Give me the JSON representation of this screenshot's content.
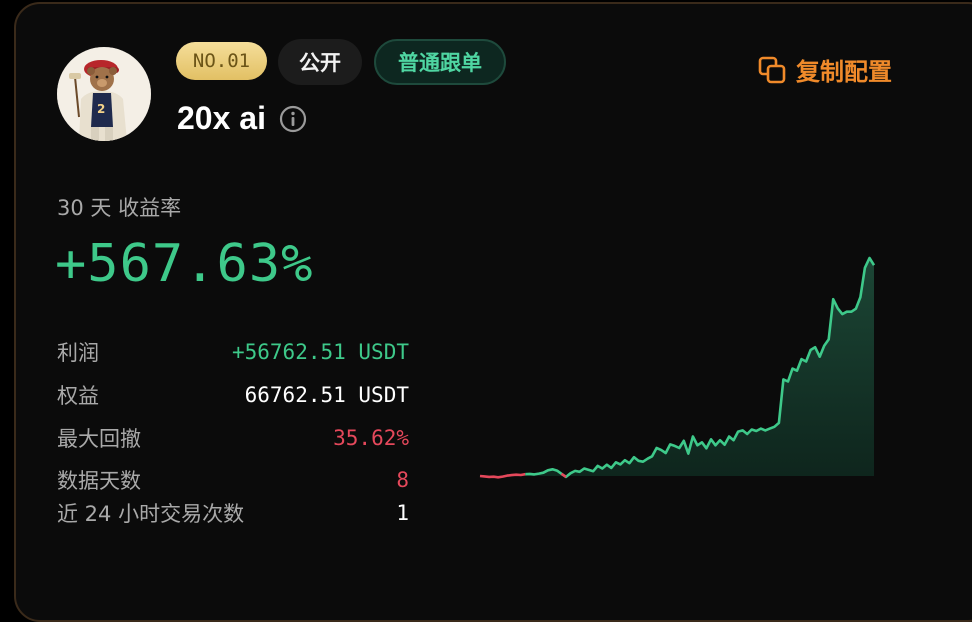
{
  "header": {
    "rank_badge": "NO.01",
    "visibility_badge": "公开",
    "mode_badge": "普通跟单",
    "copy_button_label": "复制配置",
    "trader_name": "20x ai"
  },
  "metric": {
    "label": "30 天 收益率",
    "roi": "+567.63%"
  },
  "stats": [
    {
      "label": "利润",
      "value": "+56762.51 USDT",
      "tone": "green"
    },
    {
      "label": "权益",
      "value": "66762.51 USDT",
      "tone": "white"
    },
    {
      "label": "最大回撤",
      "value": "35.62%",
      "tone": "red"
    },
    {
      "label": "数据天数",
      "value": "8",
      "tone": "red"
    },
    {
      "label": "近 24 小时交易次数",
      "value": "1",
      "tone": "white"
    }
  ],
  "colors": {
    "accent_green": "#3ec98a",
    "accent_red": "#e5485b",
    "accent_orange": "#f08a2a",
    "gold": "#e2c064"
  },
  "icons": {
    "info": "info-icon",
    "copy": "copy-icon"
  },
  "chart_data": {
    "type": "area",
    "y": [
      0,
      -0.3,
      -0.6,
      -0.5,
      -0.9,
      -0.4,
      0.3,
      0.6,
      0.9,
      0.7,
      1.2,
      1.4,
      1.1,
      1.6,
      2.2,
      3.8,
      4.5,
      3.6,
      1.5,
      -0.6,
      1.9,
      3.4,
      2.8,
      5.0,
      4.1,
      3.2,
      6.8,
      5.0,
      7.6,
      5.4,
      9.2,
      7.8,
      10.6,
      8.6,
      12.6,
      10.2,
      9.6,
      11.6,
      13.2,
      18.8,
      17.5,
      15.4,
      21.2,
      20.2,
      18.8,
      23.6,
      15.0,
      26.5,
      20.6,
      22.6,
      18.6,
      24.6,
      20.6,
      24.0,
      21.0,
      26.5,
      24.0,
      29.8,
      30.6,
      28.2,
      31.2,
      30.2,
      31.8,
      30.6,
      31.8,
      33.0,
      35.6,
      64.8,
      63.4,
      72.0,
      70.6,
      78.4,
      76.8,
      84.5,
      86.4,
      80.0,
      87.4,
      91.6,
      118.6,
      112.4,
      108.6,
      110.2,
      110.2,
      112.2,
      120.0,
      139.6,
      146.2,
      141.4
    ],
    "negative_until_index": 10,
    "dip_index": 19
  }
}
